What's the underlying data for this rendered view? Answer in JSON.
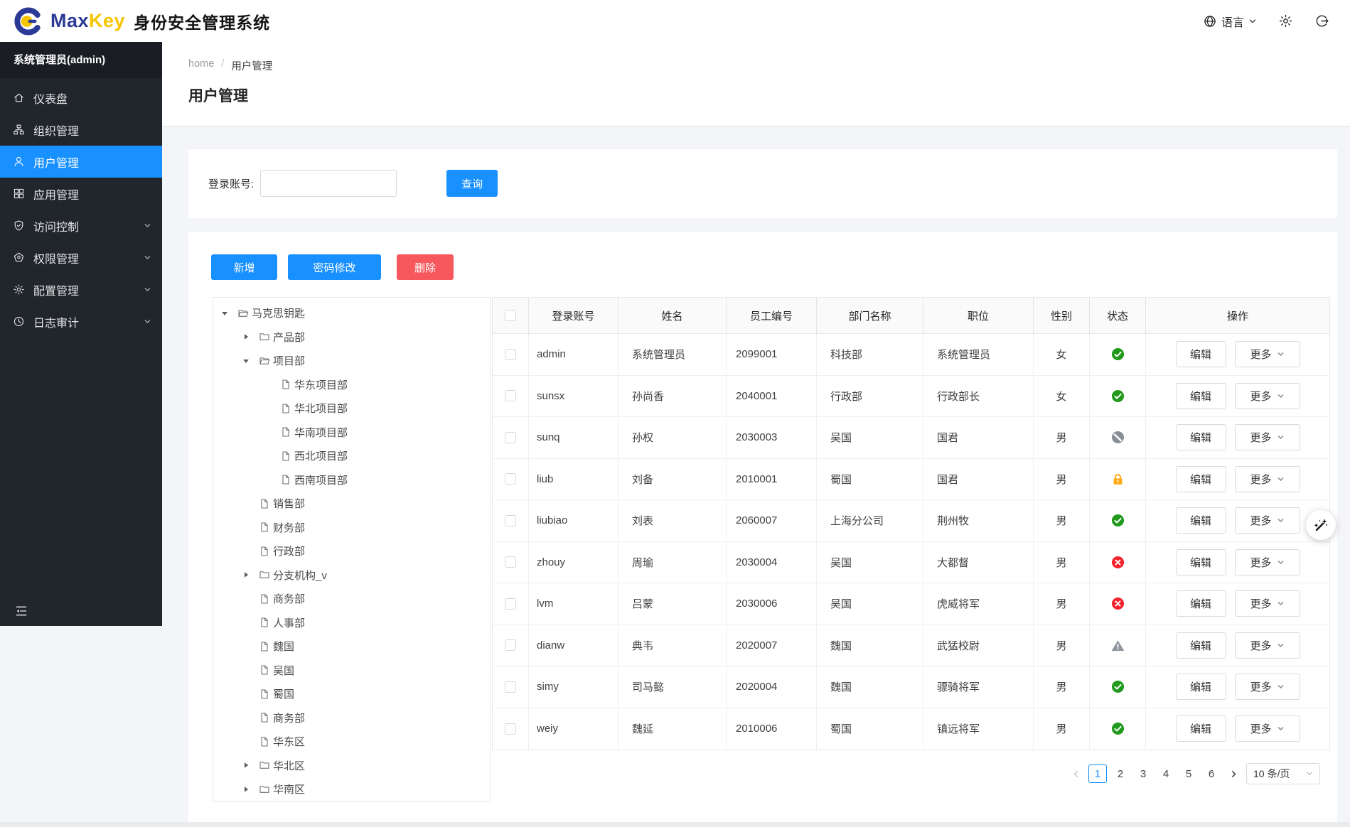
{
  "brand": {
    "max": "Max",
    "key": "Key",
    "title": "身份安全管理系统"
  },
  "topbar": {
    "language": "语言"
  },
  "sidebar": {
    "admin_label": "系统管理员(admin)",
    "items": [
      {
        "key": "dashboard",
        "label": "仪表盘",
        "active": false,
        "expandable": false
      },
      {
        "key": "org",
        "label": "组织管理",
        "active": false,
        "expandable": false
      },
      {
        "key": "user",
        "label": "用户管理",
        "active": true,
        "expandable": false
      },
      {
        "key": "app",
        "label": "应用管理",
        "active": false,
        "expandable": false
      },
      {
        "key": "access",
        "label": "访问控制",
        "active": false,
        "expandable": true
      },
      {
        "key": "permission",
        "label": "权限管理",
        "active": false,
        "expandable": true
      },
      {
        "key": "config",
        "label": "配置管理",
        "active": false,
        "expandable": true
      },
      {
        "key": "audit",
        "label": "日志审计",
        "active": false,
        "expandable": true
      }
    ]
  },
  "breadcrumb": {
    "home": "home",
    "separator": "/",
    "current": "用户管理"
  },
  "page": {
    "title": "用户管理"
  },
  "search": {
    "label": "登录账号:",
    "value": "",
    "button": "查询"
  },
  "toolbar": {
    "add": "新增",
    "change_password": "密码修改",
    "delete": "删除"
  },
  "tree": {
    "nodes": [
      {
        "label": "马克思钥匙",
        "level": 0,
        "caret": "open",
        "icon": "folder-open"
      },
      {
        "label": "产品部",
        "level": 1,
        "caret": "closed",
        "icon": "folder"
      },
      {
        "label": "项目部",
        "level": 1,
        "caret": "open",
        "icon": "folder-open"
      },
      {
        "label": "华东项目部",
        "level": 2,
        "caret": "none",
        "icon": "file"
      },
      {
        "label": "华北项目部",
        "level": 2,
        "caret": "none",
        "icon": "file"
      },
      {
        "label": "华南项目部",
        "level": 2,
        "caret": "none",
        "icon": "file"
      },
      {
        "label": "西北项目部",
        "level": 2,
        "caret": "none",
        "icon": "file"
      },
      {
        "label": "西南项目部",
        "level": 2,
        "caret": "none",
        "icon": "file"
      },
      {
        "label": "销售部",
        "level": 1,
        "caret": "none",
        "icon": "file"
      },
      {
        "label": "财务部",
        "level": 1,
        "caret": "none",
        "icon": "file"
      },
      {
        "label": "行政部",
        "level": 1,
        "caret": "none",
        "icon": "file"
      },
      {
        "label": "分支机构_v",
        "level": 1,
        "caret": "closed",
        "icon": "folder"
      },
      {
        "label": "商务部",
        "level": 1,
        "caret": "none",
        "icon": "file"
      },
      {
        "label": "人事部",
        "level": 1,
        "caret": "none",
        "icon": "file"
      },
      {
        "label": "魏国",
        "level": 1,
        "caret": "none",
        "icon": "file"
      },
      {
        "label": "吴国",
        "level": 1,
        "caret": "none",
        "icon": "file"
      },
      {
        "label": "蜀国",
        "level": 1,
        "caret": "none",
        "icon": "file"
      },
      {
        "label": "商务部",
        "level": 1,
        "caret": "none",
        "icon": "file"
      },
      {
        "label": "华东区",
        "level": 1,
        "caret": "none",
        "icon": "file"
      },
      {
        "label": "华北区",
        "level": 1,
        "caret": "closed",
        "icon": "folder"
      },
      {
        "label": "华南区",
        "level": 1,
        "caret": "closed",
        "icon": "folder"
      }
    ]
  },
  "table": {
    "columns": [
      "登录账号",
      "姓名",
      "员工编号",
      "部门名称",
      "职位",
      "性别",
      "状态",
      "操作"
    ],
    "edit_label": "编辑",
    "more_label": "更多",
    "rows": [
      {
        "account": "admin",
        "name": "系统管理员",
        "employee_id": "2099001",
        "department": "科技部",
        "position": "系统管理员",
        "gender": "女",
        "status": "active"
      },
      {
        "account": "sunsx",
        "name": "孙尚香",
        "employee_id": "2040001",
        "department": "行政部",
        "position": "行政部长",
        "gender": "女",
        "status": "active"
      },
      {
        "account": "sunq",
        "name": "孙权",
        "employee_id": "2030003",
        "department": "吴国",
        "position": "国君",
        "gender": "男",
        "status": "disabled"
      },
      {
        "account": "liub",
        "name": "刘备",
        "employee_id": "2010001",
        "department": "蜀国",
        "position": "国君",
        "gender": "男",
        "status": "locked"
      },
      {
        "account": "liubiao",
        "name": "刘表",
        "employee_id": "2060007",
        "department": "上海分公司",
        "position": "荆州牧",
        "gender": "男",
        "status": "active"
      },
      {
        "account": "zhouy",
        "name": "周瑜",
        "employee_id": "2030004",
        "department": "吴国",
        "position": "大都督",
        "gender": "男",
        "status": "inactive"
      },
      {
        "account": "lvm",
        "name": "吕蒙",
        "employee_id": "2030006",
        "department": "吴国",
        "position": "虎威将军",
        "gender": "男",
        "status": "inactive"
      },
      {
        "account": "dianw",
        "name": "典韦",
        "employee_id": "2020007",
        "department": "魏国",
        "position": "武猛校尉",
        "gender": "男",
        "status": "warning"
      },
      {
        "account": "simy",
        "name": "司马懿",
        "employee_id": "2020004",
        "department": "魏国",
        "position": "骠骑将军",
        "gender": "男",
        "status": "active"
      },
      {
        "account": "weiy",
        "name": "魏延",
        "employee_id": "2010006",
        "department": "蜀国",
        "position": "镇远将军",
        "gender": "男",
        "status": "active"
      }
    ]
  },
  "pagination": {
    "pages": [
      "1",
      "2",
      "3",
      "4",
      "5",
      "6"
    ],
    "active_page": "1",
    "page_size": "10 条/页"
  },
  "colors": {
    "accent": "#1890ff",
    "danger": "#f7585e",
    "brand_blue": "#2b3a96",
    "brand_yellow": "#f7c400",
    "status_active": "#219a1d",
    "status_inactive": "#f5222d",
    "status_locked": "#ffaa16",
    "status_disabled": "#8b9097",
    "status_warning": "#8f959e"
  },
  "icons": {
    "maxkey-logo-icon": "blue-c-ring-with-yellow-dot",
    "globe-icon": "globe",
    "gear-icon": "gear",
    "logout-icon": "logout-circle-arrow",
    "chevron-down-icon": "chevron-down",
    "menu-fold-icon": "menu-fold",
    "caret-down-icon": "caret-down",
    "caret-right-icon": "caret-right",
    "folder-open-icon": "folder-open",
    "folder-icon": "folder-closed",
    "file-icon": "document",
    "status-active-icon": "check-circle-green",
    "status-inactive-icon": "x-circle-red",
    "status-disabled-icon": "ban-circle-gray",
    "status-locked-icon": "lock-orange",
    "status-warning-icon": "warning-triangle-gray",
    "magic-wand-icon": "magic-wand-sparkles"
  }
}
